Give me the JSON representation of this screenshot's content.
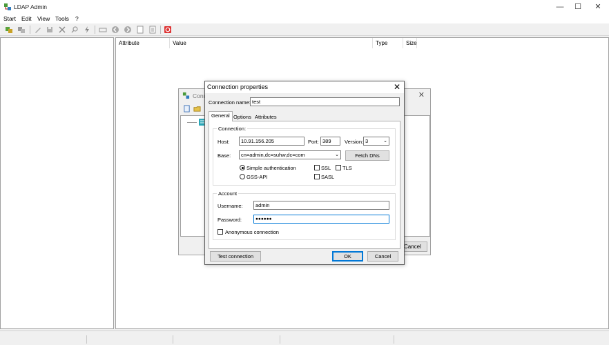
{
  "app": {
    "title": "LDAP Admin",
    "minimize": "—",
    "maximize": "☐",
    "close": "✕"
  },
  "menu": [
    "Start",
    "Edit",
    "View",
    "Tools",
    "?"
  ],
  "list_columns": [
    "Attribute",
    "Value",
    "Type",
    "Size"
  ],
  "bg_dialog": {
    "title": "Conn",
    "close": "✕",
    "cancel": "Cancel"
  },
  "dialog": {
    "title": "Connection properties",
    "close": "✕",
    "connection_name_label": "Connection name:",
    "connection_name_value": "test",
    "tabs": [
      "General",
      "Options",
      "Attributes"
    ],
    "connection_group": "Connection:",
    "host_label": "Host:",
    "host_value": "10.91.156.205",
    "port_label": "Port:",
    "port_value": "389",
    "version_label": "Version:",
    "version_value": "3",
    "base_label": "Base:",
    "base_value": "cn=admin,dc=suhw,dc=com",
    "fetch_dns": "Fetch DNs",
    "simple_auth": "Simple authentication",
    "gss_api": "GSS-API",
    "ssl": "SSL",
    "tls": "TLS",
    "sasl": "SASL",
    "account_group": "Account",
    "username_label": "Username:",
    "username_value": "admin",
    "password_label": "Password:",
    "password_value": "●●●●●●",
    "anonymous": "Anonymous connection",
    "test_connection": "Test connection",
    "ok": "OK",
    "cancel": "Cancel"
  },
  "colors": {
    "accent": "#0078d7",
    "border": "#adadad"
  }
}
